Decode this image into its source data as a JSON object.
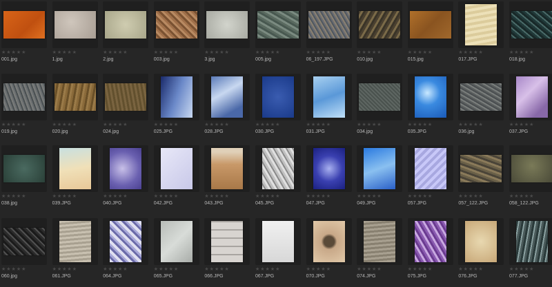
{
  "rating_glyph": "★★★★★",
  "items": [
    {
      "name": "001.jpg",
      "orient": "landscape",
      "bg": "linear-gradient(135deg,#d86418,#c05010 60%,#e07020)"
    },
    {
      "name": "1.jpg",
      "orient": "landscape",
      "bg": "radial-gradient(circle at 40% 40%,#cfc6bc,#a89e94)"
    },
    {
      "name": "2.jpg",
      "orient": "landscape",
      "bg": "radial-gradient(circle at 50% 50%,#cfccb0,#a8a68a)"
    },
    {
      "name": "003.jpg",
      "orient": "landscape",
      "bg": "repeating-linear-gradient(45deg,#a0704a 0 3px,#7a5232 3px 6px,#b88a62 6px 9px)"
    },
    {
      "name": "3.jpg",
      "orient": "landscape",
      "bg": "radial-gradient(circle at 50% 50%,#d2d4cc,#a8aaa2)"
    },
    {
      "name": "005.jpg",
      "orient": "landscape",
      "bg": "repeating-linear-gradient(30deg,#5a6a60 0 3px,#7a8a80 3px 6px,#485850 6px 9px)"
    },
    {
      "name": "06_197.JPG",
      "orient": "landscape",
      "bg": "repeating-linear-gradient(60deg,#6a6c72 0 2px,#8a8070 2px 4px,#505860 4px 6px)"
    },
    {
      "name": "010.jpg",
      "orient": "landscape",
      "bg": "repeating-linear-gradient(120deg,#4a4030 0 3px,#7a6a48 3px 6px,#3a3428 6px 9px)"
    },
    {
      "name": "015.jpg",
      "orient": "landscape",
      "bg": "linear-gradient(135deg,#b0702a,#8a5420 50%,#a0682c)"
    },
    {
      "name": "017.JPG",
      "orient": "portrait",
      "bg": "repeating-linear-gradient(170deg,#ece0b8 0 4px,#dccc9c 4px 8px)"
    },
    {
      "name": "018.jpg",
      "orient": "landscape",
      "bg": "repeating-linear-gradient(40deg,#203838 0 3px,#4a6a68 3px 5px,#182828 5px 8px)"
    },
    {
      "name": "019.jpg",
      "orient": "landscape",
      "bg": "repeating-linear-gradient(70deg,#6a6e70 0 2px,#4a5052 2px 4px,#7a7c7a 4px 6px)"
    },
    {
      "name": "020.jpg",
      "orient": "landscape",
      "bg": "repeating-linear-gradient(100deg,#8a6a3a 0 3px,#6a5028 3px 6px,#9a7a48 6px 9px)"
    },
    {
      "name": "024.jpg",
      "orient": "landscape",
      "bg": "repeating-linear-gradient(80deg,#7a6440 0 3px,#62502e 3px 6px)"
    },
    {
      "name": "025.JPG",
      "orient": "portrait",
      "bg": "linear-gradient(110deg,#1a2a6a,#6a88c8 50%,#c8d8f0)"
    },
    {
      "name": "028.JPG",
      "orient": "portrait",
      "bg": "linear-gradient(150deg,#5a7ab8,#c8d8f0 40%,#4a68a8 80%)"
    },
    {
      "name": "030.JPG",
      "orient": "portrait",
      "bg": "radial-gradient(circle at 50% 50%,#3a5cb0,#1a3a8a)"
    },
    {
      "name": "031.JPG",
      "orient": "portrait",
      "bg": "linear-gradient(160deg,#a8d0f0,#5a98d8 50%,#c0e0f8)"
    },
    {
      "name": "034.jpg",
      "orient": "landscape",
      "bg": "repeating-linear-gradient(45deg,#4a524e 0 2px,#5e6662 2px 4px)"
    },
    {
      "name": "035.JPG",
      "orient": "portrait",
      "bg": "radial-gradient(circle at 40% 40%,#c8e8ff,#3a8ae0 40%,#1a5ab8)"
    },
    {
      "name": "036.jpg",
      "orient": "landscape",
      "bg": "repeating-linear-gradient(30deg,#5a5e5e 0 2px,#7a7e7c 2px 4px,#4a4e50 4px 6px)"
    },
    {
      "name": "037.JPG",
      "orient": "portrait",
      "bg": "linear-gradient(135deg,#a888c8,#d8c0e8 40%,#8868a8 80%)"
    },
    {
      "name": "038.jpg",
      "orient": "landscape",
      "bg": "radial-gradient(circle at 50% 50%,#4a6a60,#2a4038)"
    },
    {
      "name": "039.JPG",
      "orient": "portrait",
      "bg": "linear-gradient(170deg,#c8e0e0,#f0e0b8 50%,#e8c898)"
    },
    {
      "name": "040.JPG",
      "orient": "portrait",
      "bg": "radial-gradient(circle at 40% 50%,#c8c0e8,#6a60b0 60%,#4a4090)"
    },
    {
      "name": "042.JPG",
      "orient": "portrait",
      "bg": "linear-gradient(135deg,#e8e8f8,#c8c8e8)"
    },
    {
      "name": "043.JPG",
      "orient": "portrait",
      "bg": "linear-gradient(180deg,#e0d0b8 10%,#c89868 40%,#a87848)"
    },
    {
      "name": "045.JPG",
      "orient": "portrait",
      "bg": "repeating-linear-gradient(60deg,#e0e0e0 0 3px,#8a8a8a 3px 5px,#c0c0c0 5px 8px)"
    },
    {
      "name": "047.JPG",
      "orient": "portrait",
      "bg": "radial-gradient(circle at 50% 50%,#a8b0f0,#3a40b0 50%,#1a2080)"
    },
    {
      "name": "049.JPG",
      "orient": "portrait",
      "bg": "linear-gradient(160deg,#2a7ae0,#8ac0f0 50%,#2a60c8)"
    },
    {
      "name": "057.JPG",
      "orient": "portrait",
      "bg": "repeating-linear-gradient(135deg,#c8c8f8 0 4px,#a8a8e0 4px 8px)"
    },
    {
      "name": "057_122.JPG",
      "orient": "landscape",
      "bg": "repeating-linear-gradient(20deg,#6a6048 0 3px,#8a7a5a 3px 6px,#4a4438 6px 9px)"
    },
    {
      "name": "058_122.JPG",
      "orient": "landscape",
      "bg": "radial-gradient(circle at 50% 40%,#7a7a58,#4a4a38)"
    },
    {
      "name": "060.jpg",
      "orient": "landscape",
      "bg": "repeating-linear-gradient(45deg,#2a2a2a 0 3px,#505050 3px 5px,#1a1a1a 5px 8px)"
    },
    {
      "name": "061.JPG",
      "orient": "portrait",
      "bg": "repeating-linear-gradient(175deg,#c8c0b0 0 3px,#a8a090 3px 6px)"
    },
    {
      "name": "064.JPG",
      "orient": "portrait",
      "bg": "repeating-linear-gradient(45deg,#e0e0f0 0 4px,#6a6aa8 4px 7px,#a8a8d8 7px 10px)"
    },
    {
      "name": "065.JPG",
      "orient": "portrait",
      "bg": "linear-gradient(135deg,#b8bcb8,#d8dcd8 50%,#a8aca8)"
    },
    {
      "name": "066.JPG",
      "orient": "portrait",
      "bg": "repeating-linear-gradient(0deg,#d8d4d0 0 10px,#a8a4a0 10px 12px)"
    },
    {
      "name": "067.JPG",
      "orient": "portrait",
      "bg": "linear-gradient(180deg,#f0f0f0,#d8d8d8)"
    },
    {
      "name": "070.JPG",
      "orient": "portrait",
      "bg": "radial-gradient(circle at 50% 50%,#5a4a38 20%,#c8a888 30%,#e0c8a8)"
    },
    {
      "name": "074.JPG",
      "orient": "portrait",
      "bg": "repeating-linear-gradient(175deg,#a8a090 0 3px,#888070 3px 6px)"
    },
    {
      "name": "075.JPG",
      "orient": "portrait",
      "bg": "repeating-linear-gradient(60deg,#8a5ab0 0 3px,#c8a8e0 3px 6px,#6a3a90 6px 9px)"
    },
    {
      "name": "076.JPG",
      "orient": "portrait",
      "bg": "radial-gradient(circle at 50% 50%,#e8d8b0,#c8a878)"
    },
    {
      "name": "077.JPG",
      "orient": "portrait",
      "bg": "repeating-linear-gradient(100deg,#2a3a3a 0 3px,#8aa0a0 3px 5px,#4a5a5a 5px 8px)"
    }
  ]
}
